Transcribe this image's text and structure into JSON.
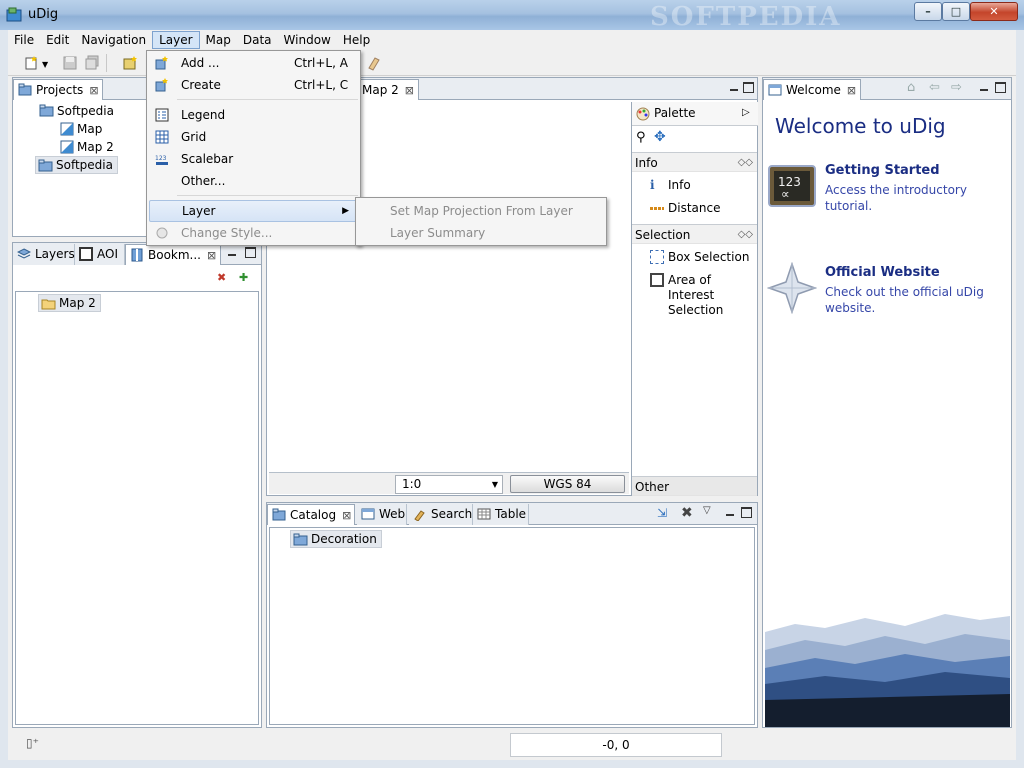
{
  "window": {
    "title": "uDig",
    "watermark": "SOFTPEDIA",
    "controls": {
      "minimize": "–",
      "maximize": "□",
      "close": "✕"
    }
  },
  "menubar": {
    "items": [
      {
        "label": "File"
      },
      {
        "label": "Edit"
      },
      {
        "label": "Navigation"
      },
      {
        "label": "Layer",
        "active": true
      },
      {
        "label": "Map"
      },
      {
        "label": "Data"
      },
      {
        "label": "Window"
      },
      {
        "label": "Help"
      }
    ]
  },
  "layer_menu": {
    "items": [
      {
        "label": "Add ...",
        "accelerator": "Ctrl+L, A",
        "icon": "add-layer-icon"
      },
      {
        "label": "Create",
        "accelerator": "Ctrl+L, C",
        "icon": "create-layer-icon"
      },
      {
        "label": "Legend",
        "icon": "legend-icon"
      },
      {
        "label": "Grid",
        "icon": "grid-icon"
      },
      {
        "label": "Scalebar",
        "icon": "scalebar-icon"
      },
      {
        "label": "Other..."
      },
      {
        "label": "Layer",
        "highlighted": true,
        "submenu": true
      },
      {
        "label": "Change Style...",
        "disabled": true,
        "icon": "change-style-icon"
      }
    ],
    "submenu": [
      {
        "label": "Set Map Projection From Layer",
        "disabled": true
      },
      {
        "label": "Layer Summary",
        "disabled": true
      }
    ]
  },
  "projects_panel": {
    "tab": "Projects",
    "tree": [
      {
        "label": "Softpedia",
        "level": 0
      },
      {
        "label": "Map",
        "level": 1
      },
      {
        "label": "Map 2",
        "level": 1
      },
      {
        "label": "Softpedia",
        "level": 0,
        "selected": true
      }
    ]
  },
  "layers_panel": {
    "tabs": [
      "Layers",
      "AOI",
      "Bookm..."
    ],
    "tree": [
      {
        "label": "Map 2",
        "selected": true
      }
    ]
  },
  "map_editor": {
    "tab": "Map 2",
    "scale": "1:0",
    "crs": "WGS 84"
  },
  "palette": {
    "title": "Palette",
    "sections": [
      {
        "label": "Info",
        "items": [
          "Info",
          "Distance"
        ]
      },
      {
        "label": "Selection",
        "items": [
          "Box Selection",
          "Area of Interest Selection"
        ]
      },
      {
        "label": "Other",
        "items": []
      }
    ]
  },
  "catalog_panel": {
    "tabs": [
      "Catalog",
      "Web",
      "Search",
      "Table"
    ],
    "tree": [
      {
        "label": "Decoration"
      }
    ]
  },
  "welcome_panel": {
    "tab": "Welcome",
    "title": "Welcome to uDig",
    "entries": [
      {
        "heading": "Getting Started",
        "description": "Access the introductory tutorial."
      },
      {
        "heading": "Official Website",
        "description": "Check out the official uDig website."
      }
    ]
  },
  "statusbar": {
    "coordinates": "-0, 0"
  },
  "colors": {
    "welcome_text": "#1a2d83",
    "welcome_link": "#3546a8",
    "titlebar": "#a5c1e0"
  }
}
